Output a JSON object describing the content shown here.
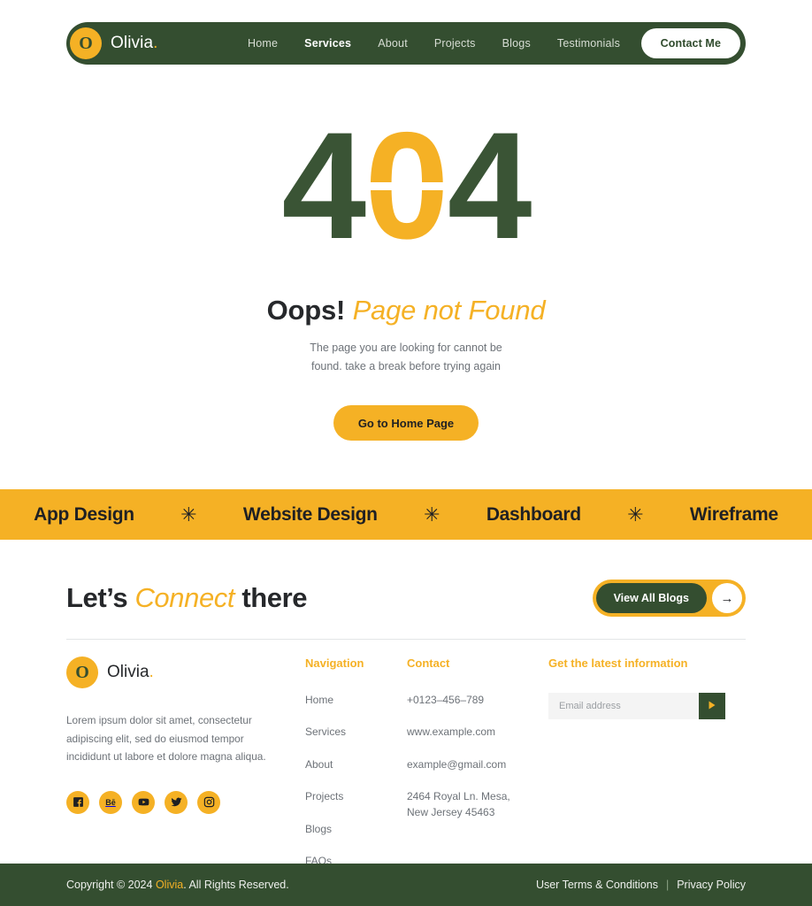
{
  "header": {
    "logo_letter": "O",
    "brand_name": "Olivia",
    "brand_dot": ".",
    "nav_items": [
      {
        "label": "Home",
        "active": false
      },
      {
        "label": "Services",
        "active": true
      },
      {
        "label": "About",
        "active": false
      },
      {
        "label": "Projects",
        "active": false
      },
      {
        "label": "Blogs",
        "active": false
      },
      {
        "label": "Testimonials",
        "active": false
      }
    ],
    "contact_label": "Contact Me"
  },
  "hero": {
    "code_first": "4",
    "code_zero": "0",
    "code_last": "4",
    "title_bold": "Oops!",
    "title_italic": "Page not Found",
    "description_line1": "The page you are looking for cannot be",
    "description_line2": "found. take a break before trying again",
    "button_label": "Go to Home Page"
  },
  "marquee": {
    "items": [
      "App Design",
      "Website Design",
      "Dashboard",
      "Wireframe"
    ],
    "separator_glyph": "✳"
  },
  "connect": {
    "title_part1": "Let’s",
    "title_italic": "Connect",
    "title_part2": "there",
    "button_label": "View All Blogs",
    "arrow_glyph": "→"
  },
  "footer": {
    "logo_letter": "O",
    "brand_name": "Olivia",
    "brand_dot": ".",
    "description": "Lorem ipsum dolor sit amet, consectetur adipiscing elit, sed do eiusmod tempor incididunt ut labore et dolore magna aliqua.",
    "socials": [
      {
        "name": "facebook-icon"
      },
      {
        "name": "behance-icon"
      },
      {
        "name": "youtube-icon"
      },
      {
        "name": "twitter-icon"
      },
      {
        "name": "instagram-icon"
      }
    ],
    "navigation": {
      "heading": "Navigation",
      "links": [
        "Home",
        "Services",
        "About",
        "Projects",
        "Blogs",
        "FAQs"
      ]
    },
    "contact": {
      "heading": "Contact",
      "phone": "+0123–456–789",
      "website": "www.example.com",
      "email": "example@gmail.com",
      "address_line1": "2464 Royal Ln. Mesa,",
      "address_line2": "New Jersey 45463"
    },
    "newsletter": {
      "heading": "Get the latest information",
      "placeholder": "Email address",
      "value": ""
    }
  },
  "bottombar": {
    "copyright_prefix": "Copyright © 2024 ",
    "copyright_brand": "Olivia",
    "copyright_suffix": ". All Rights Reserved.",
    "terms_label": "User Terms & Conditions",
    "separator": "|",
    "privacy_label": "Privacy Policy"
  },
  "colors": {
    "green": "#344E30",
    "orange": "#F5B125",
    "dark_text": "#26282b",
    "muted_text": "#6d7278"
  }
}
